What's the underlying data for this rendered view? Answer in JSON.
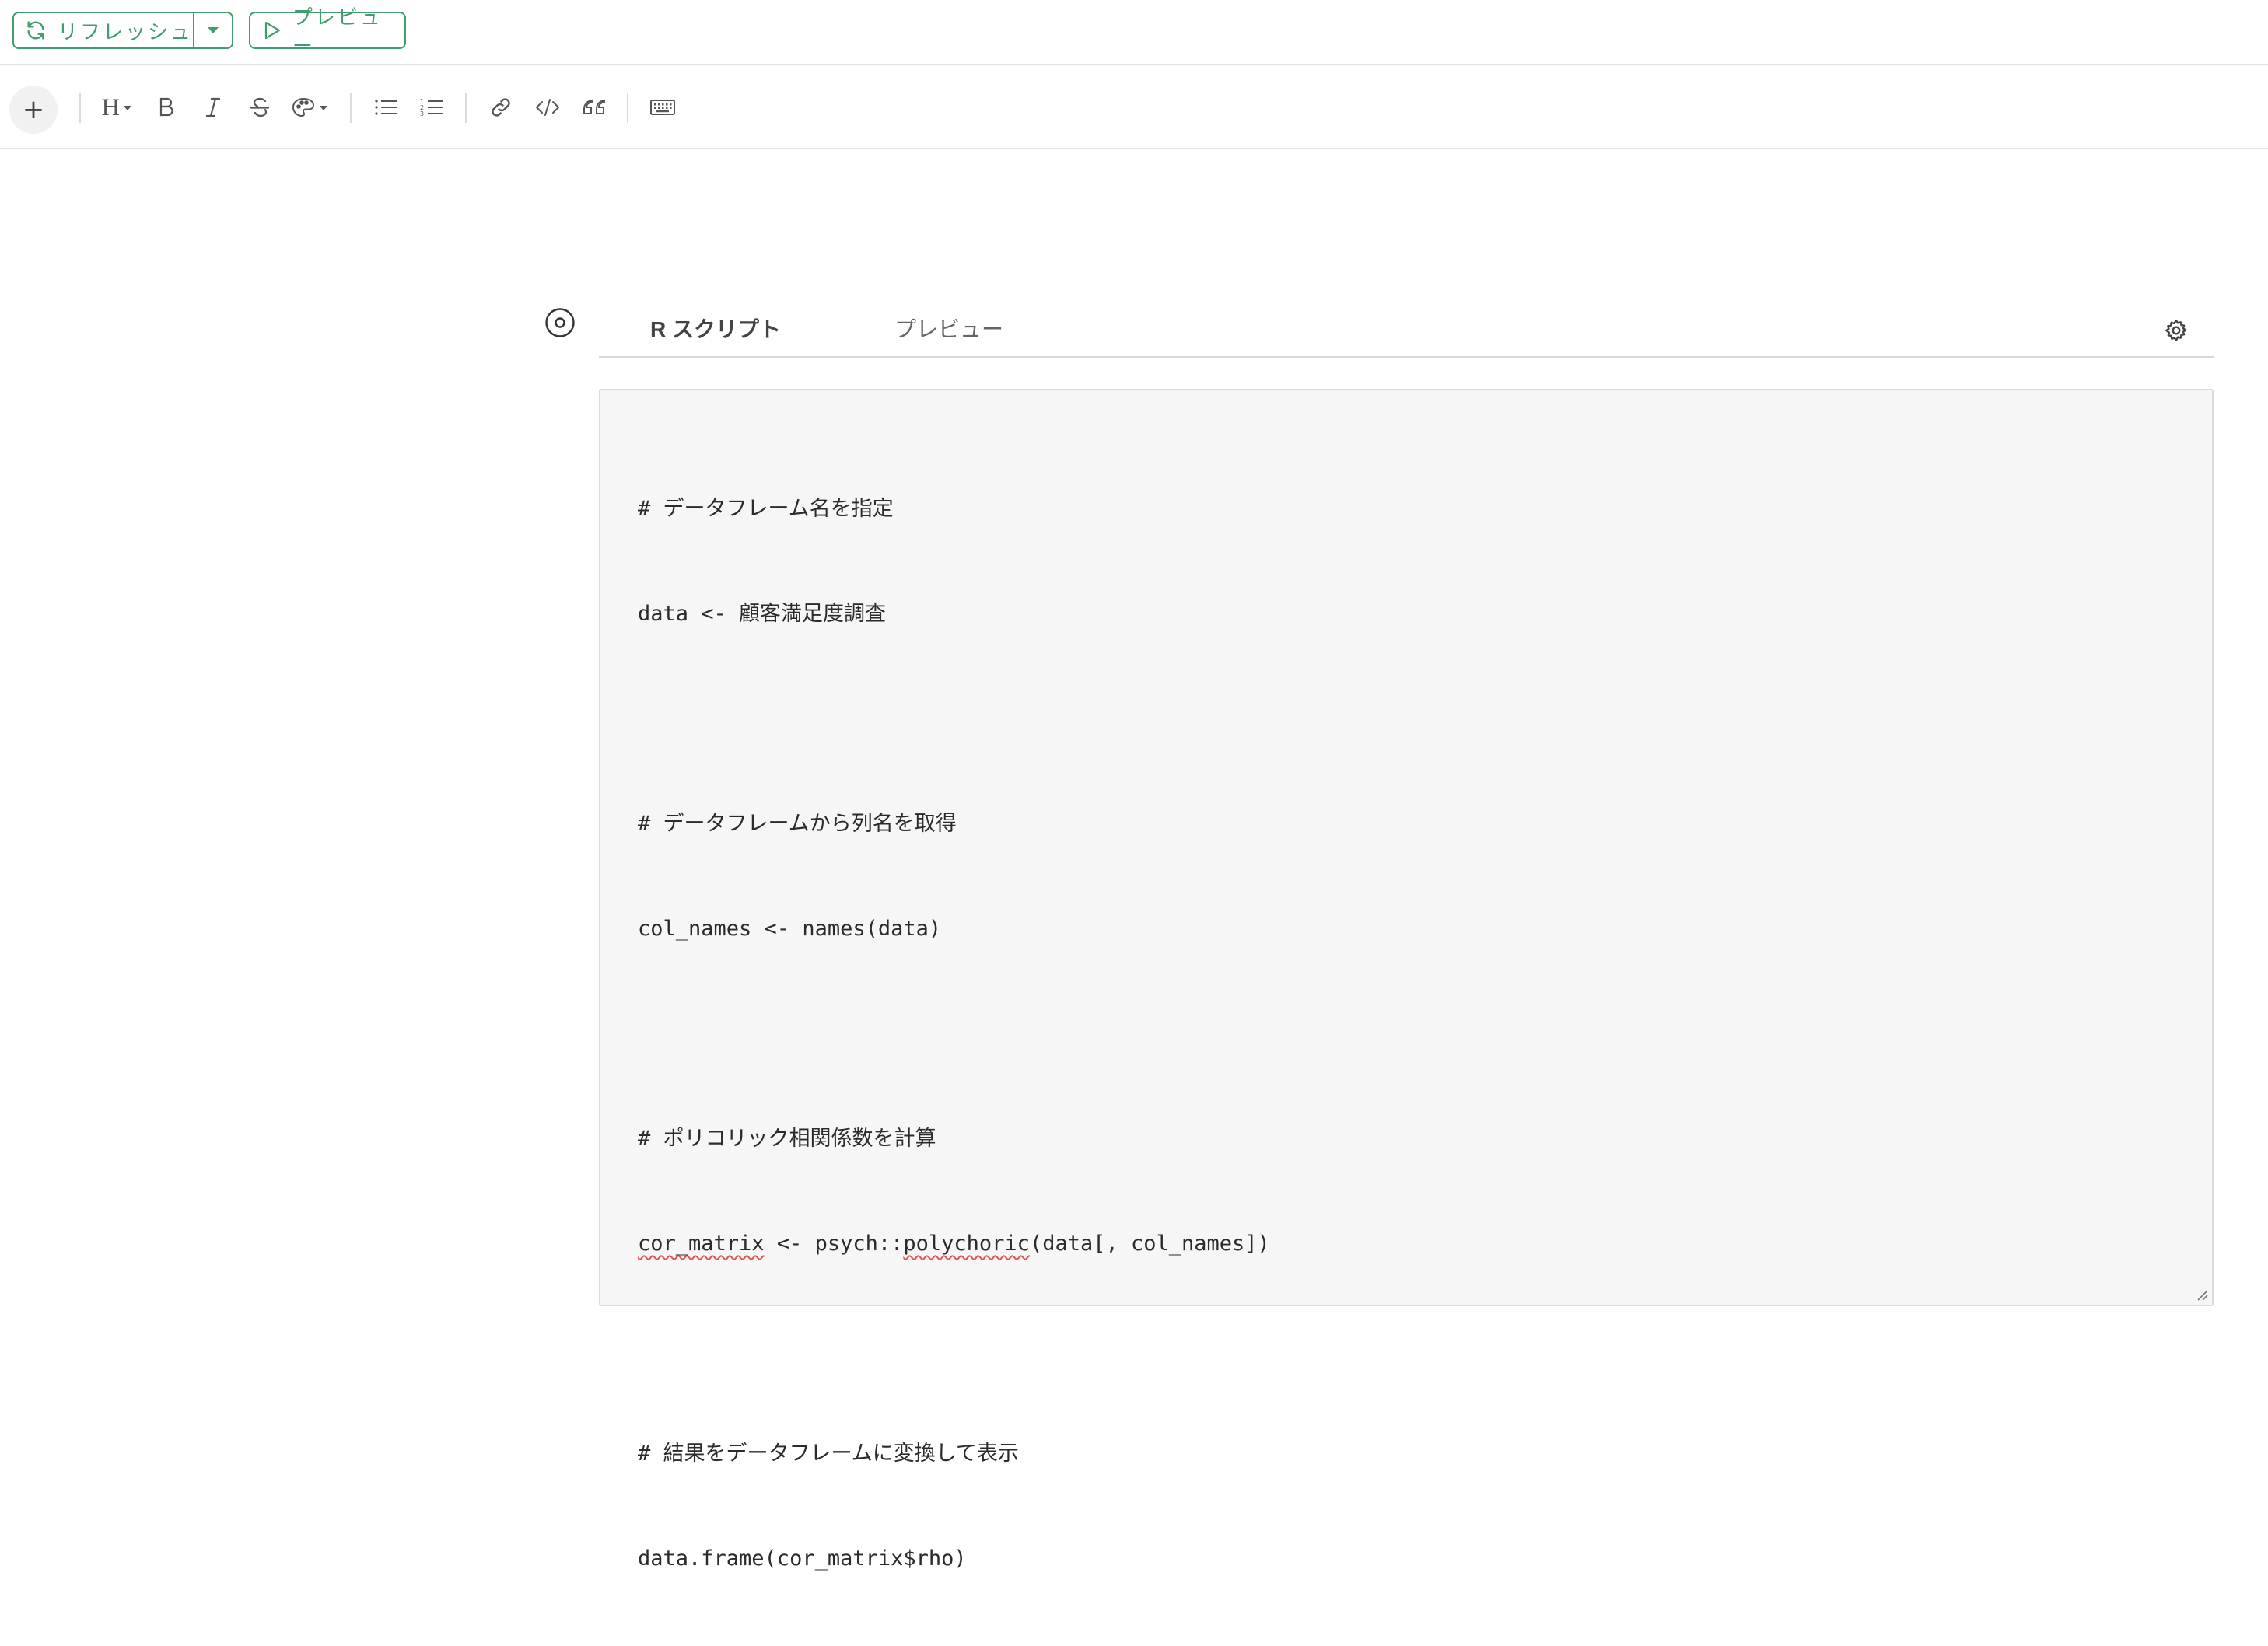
{
  "topbar": {
    "refresh_label": "リフレッシュ",
    "preview_label": "プレビュー"
  },
  "toolbar": {
    "items": [
      {
        "name": "insert-plus-icon",
        "glyph": "+"
      },
      {
        "name": "heading-icon"
      },
      {
        "name": "bold-icon"
      },
      {
        "name": "italic-icon"
      },
      {
        "name": "strikethrough-icon"
      },
      {
        "name": "color-palette-icon"
      },
      {
        "name": "bullet-list-icon"
      },
      {
        "name": "numbered-list-icon"
      },
      {
        "name": "link-icon"
      },
      {
        "name": "code-icon"
      },
      {
        "name": "quote-icon"
      },
      {
        "name": "keyboard-icon"
      }
    ]
  },
  "cell": {
    "tabs": {
      "r_script": "R スクリプト",
      "preview": "プレビュー"
    },
    "code_lines": [
      "# データフレーム名を指定",
      "data <- 顧客満足度調査",
      "",
      "# データフレームから列名を取得",
      "col_names <- names(data)",
      "",
      "# ポリコリック相関係数を計算",
      "cor_matrix <- psych::polychoric(data[, col_names])",
      "",
      "# 結果をデータフレームに変換して表示",
      "data.frame(cor_matrix$rho)"
    ],
    "line7_parts": {
      "a": "cor_matrix",
      "b": " <- psych::",
      "c": "polychoric",
      "d": "(data[, col_names])"
    }
  },
  "colors": {
    "accent": "#3f9e6b",
    "editor_bg": "#f6f6f6",
    "spell_error": "#e05555"
  }
}
